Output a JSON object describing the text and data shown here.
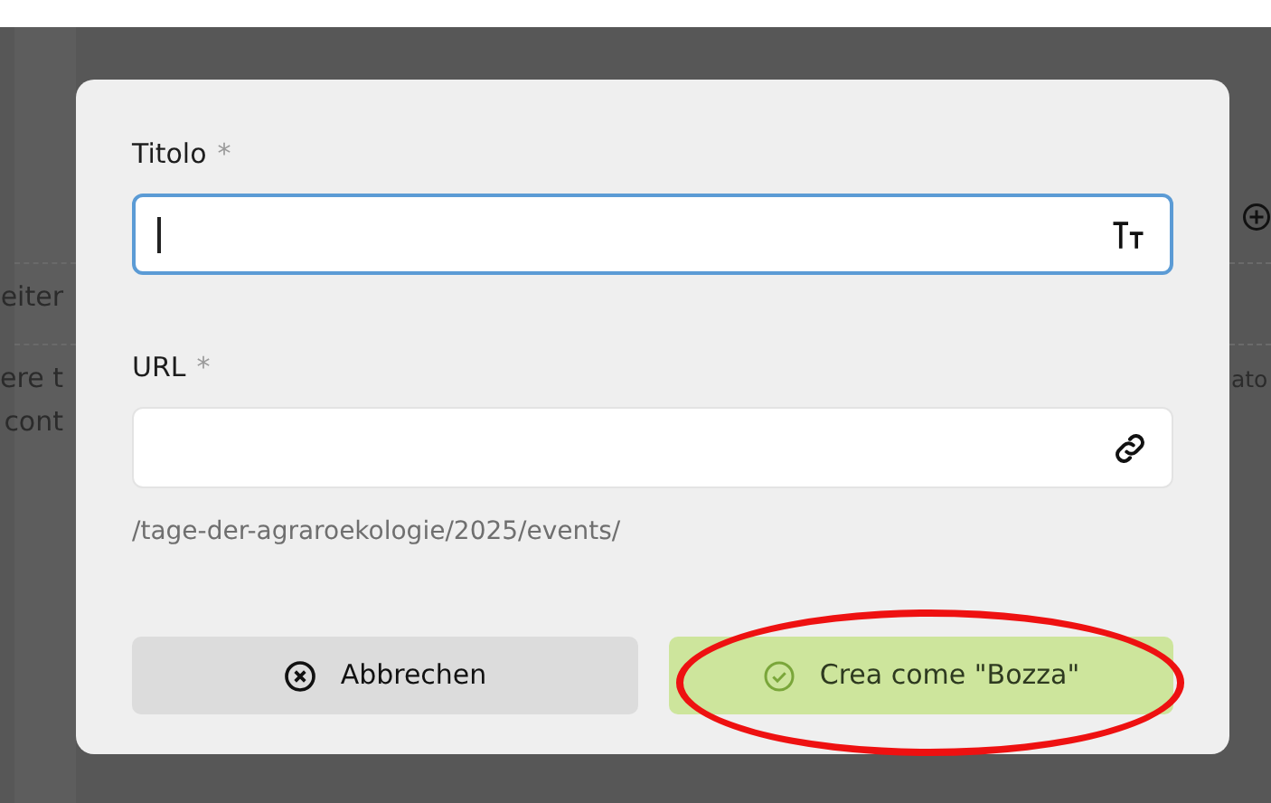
{
  "background_page": {
    "left_texts": [
      "eiter",
      "ere t",
      "cont"
    ],
    "right_texts": [
      "ato"
    ]
  },
  "dialog": {
    "fields": [
      {
        "label": "Titolo",
        "required_mark": "*",
        "focused": true
      },
      {
        "label": "URL",
        "required_mark": "*",
        "focused": false,
        "hint": "/tage-der-agraroekologie/2025/events/"
      }
    ],
    "buttons": [
      {
        "label": "Abbrechen",
        "kind": "secondary",
        "highlighted": false
      },
      {
        "label": "Crea come \"Bozza\"",
        "kind": "primary",
        "highlighted": true
      }
    ]
  }
}
